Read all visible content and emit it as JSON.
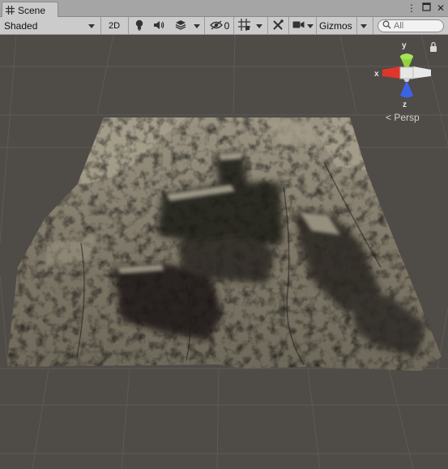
{
  "tab": {
    "label": "Scene"
  },
  "window_controls": {
    "menu": "⋮",
    "maximize": "□",
    "close": "✕"
  },
  "toolbar": {
    "shading_mode": "Shaded",
    "mode_2d": "2D",
    "hidden_count": "0",
    "gizmos_label": "Gizmos",
    "search_placeholder": "All"
  },
  "gizmo": {
    "x_label": "x",
    "y_label": "y",
    "z_label": "z",
    "projection_label": "< Persp",
    "colors": {
      "x": "#e0352b",
      "y": "#8fd33a",
      "z": "#3b63e6",
      "neutral": "#e8e8e8"
    }
  },
  "scene": {
    "background_color": "#504c48",
    "terrain_color": "#8a8474"
  }
}
